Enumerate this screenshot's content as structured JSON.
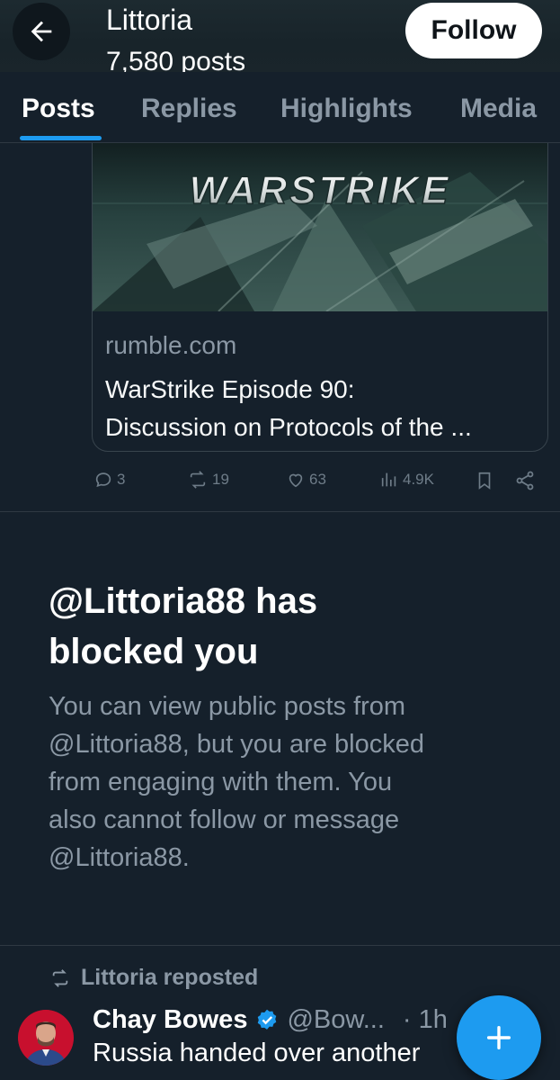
{
  "header": {
    "title": "Littoria",
    "subtitle": "7,580 posts",
    "follow_label": "Follow",
    "back_icon": "arrow-left-icon"
  },
  "tabs": [
    {
      "label": "Posts",
      "active": true
    },
    {
      "label": "Replies",
      "active": false
    },
    {
      "label": "Highlights",
      "active": false
    },
    {
      "label": "Media",
      "active": false
    }
  ],
  "link_card": {
    "image_text": "WARSTRIKE",
    "domain": "rumble.com",
    "title_line1": "WarStrike Episode 90:",
    "title_line2": "Discussion on Protocols of the ..."
  },
  "actions": {
    "replies": "3",
    "reposts": "19",
    "likes": "63",
    "views": "4.9K"
  },
  "block_notice": {
    "title_line1": "@Littoria88 has",
    "title_line2": "blocked you",
    "line1": "You can view public posts from",
    "line2": "@Littoria88, but you are blocked",
    "line3": "from engaging with them. You",
    "line4": "also cannot follow or message",
    "line5": "@Littoria88."
  },
  "repost": {
    "label": "Littoria reposted",
    "author_name": "Chay Bowes",
    "handle": "@Bow...",
    "time": "· 1h",
    "text": "Russia handed over another"
  },
  "colors": {
    "background": "#15202b",
    "accent": "#1d9bf0",
    "muted": "#8b98a5",
    "divider": "#2f3942"
  }
}
